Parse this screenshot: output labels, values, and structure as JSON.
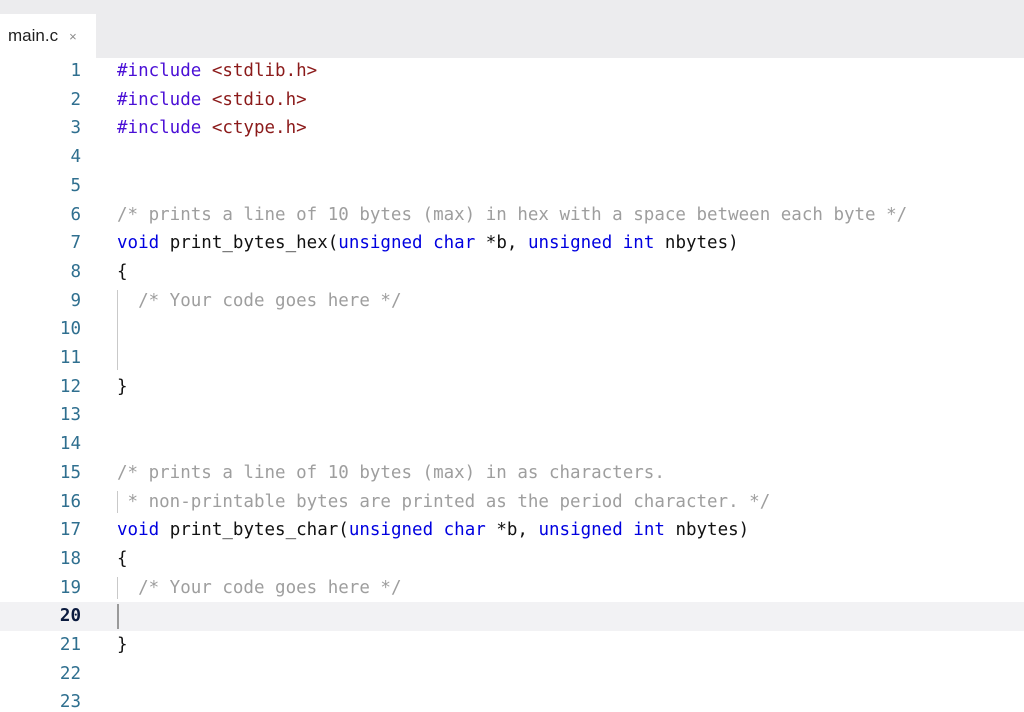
{
  "tab": {
    "filename": "main.c",
    "close_glyph": "×"
  },
  "editor": {
    "current_line": 20,
    "lines": [
      {
        "num": "1",
        "tokens": [
          {
            "t": "pp",
            "v": "#include "
          },
          {
            "t": "str",
            "v": "<stdlib.h>"
          }
        ]
      },
      {
        "num": "2",
        "tokens": [
          {
            "t": "pp",
            "v": "#include "
          },
          {
            "t": "str",
            "v": "<stdio.h>"
          }
        ]
      },
      {
        "num": "3",
        "tokens": [
          {
            "t": "pp",
            "v": "#include "
          },
          {
            "t": "str",
            "v": "<ctype.h>"
          }
        ]
      },
      {
        "num": "4",
        "tokens": []
      },
      {
        "num": "5",
        "tokens": []
      },
      {
        "num": "6",
        "tokens": [
          {
            "t": "com",
            "v": "/* prints a line of 10 bytes (max) in hex with a space between each byte */"
          }
        ]
      },
      {
        "num": "7",
        "tokens": [
          {
            "t": "kw",
            "v": "void"
          },
          {
            "t": "plain",
            "v": " print_bytes_hex("
          },
          {
            "t": "kw",
            "v": "unsigned char"
          },
          {
            "t": "plain",
            "v": " *b, "
          },
          {
            "t": "kw",
            "v": "unsigned int"
          },
          {
            "t": "plain",
            "v": " nbytes)"
          }
        ]
      },
      {
        "num": "8",
        "tokens": [
          {
            "t": "plain",
            "v": "{"
          }
        ]
      },
      {
        "num": "9",
        "tokens": [
          {
            "t": "plain",
            "v": "  "
          },
          {
            "t": "com",
            "v": "/* Your code goes here */"
          }
        ]
      },
      {
        "num": "10",
        "tokens": []
      },
      {
        "num": "11",
        "tokens": []
      },
      {
        "num": "12",
        "tokens": [
          {
            "t": "plain",
            "v": "}"
          }
        ]
      },
      {
        "num": "13",
        "tokens": []
      },
      {
        "num": "14",
        "tokens": []
      },
      {
        "num": "15",
        "tokens": [
          {
            "t": "com",
            "v": "/* prints a line of 10 bytes (max) in as characters."
          }
        ]
      },
      {
        "num": "16",
        "tokens": [
          {
            "t": "com",
            "v": " * non-printable bytes are printed as the period character. */"
          }
        ]
      },
      {
        "num": "17",
        "tokens": [
          {
            "t": "kw",
            "v": "void"
          },
          {
            "t": "plain",
            "v": " print_bytes_char("
          },
          {
            "t": "kw",
            "v": "unsigned char"
          },
          {
            "t": "plain",
            "v": " *b, "
          },
          {
            "t": "kw",
            "v": "unsigned int"
          },
          {
            "t": "plain",
            "v": " nbytes)"
          }
        ]
      },
      {
        "num": "18",
        "tokens": [
          {
            "t": "plain",
            "v": "{"
          }
        ]
      },
      {
        "num": "19",
        "tokens": [
          {
            "t": "plain",
            "v": "  "
          },
          {
            "t": "com",
            "v": "/* Your code goes here */"
          }
        ]
      },
      {
        "num": "20",
        "tokens": []
      },
      {
        "num": "21",
        "tokens": [
          {
            "t": "plain",
            "v": "}"
          }
        ]
      },
      {
        "num": "22",
        "tokens": []
      },
      {
        "num": "23",
        "tokens": []
      }
    ]
  },
  "colors": {
    "preprocessor": "#4a0fd6",
    "string": "#8b1a1a",
    "keyword": "#0000e0",
    "comment": "#9e9e9e",
    "line_number": "#2f6f8f",
    "current_line_bg": "#f2f2f4"
  }
}
